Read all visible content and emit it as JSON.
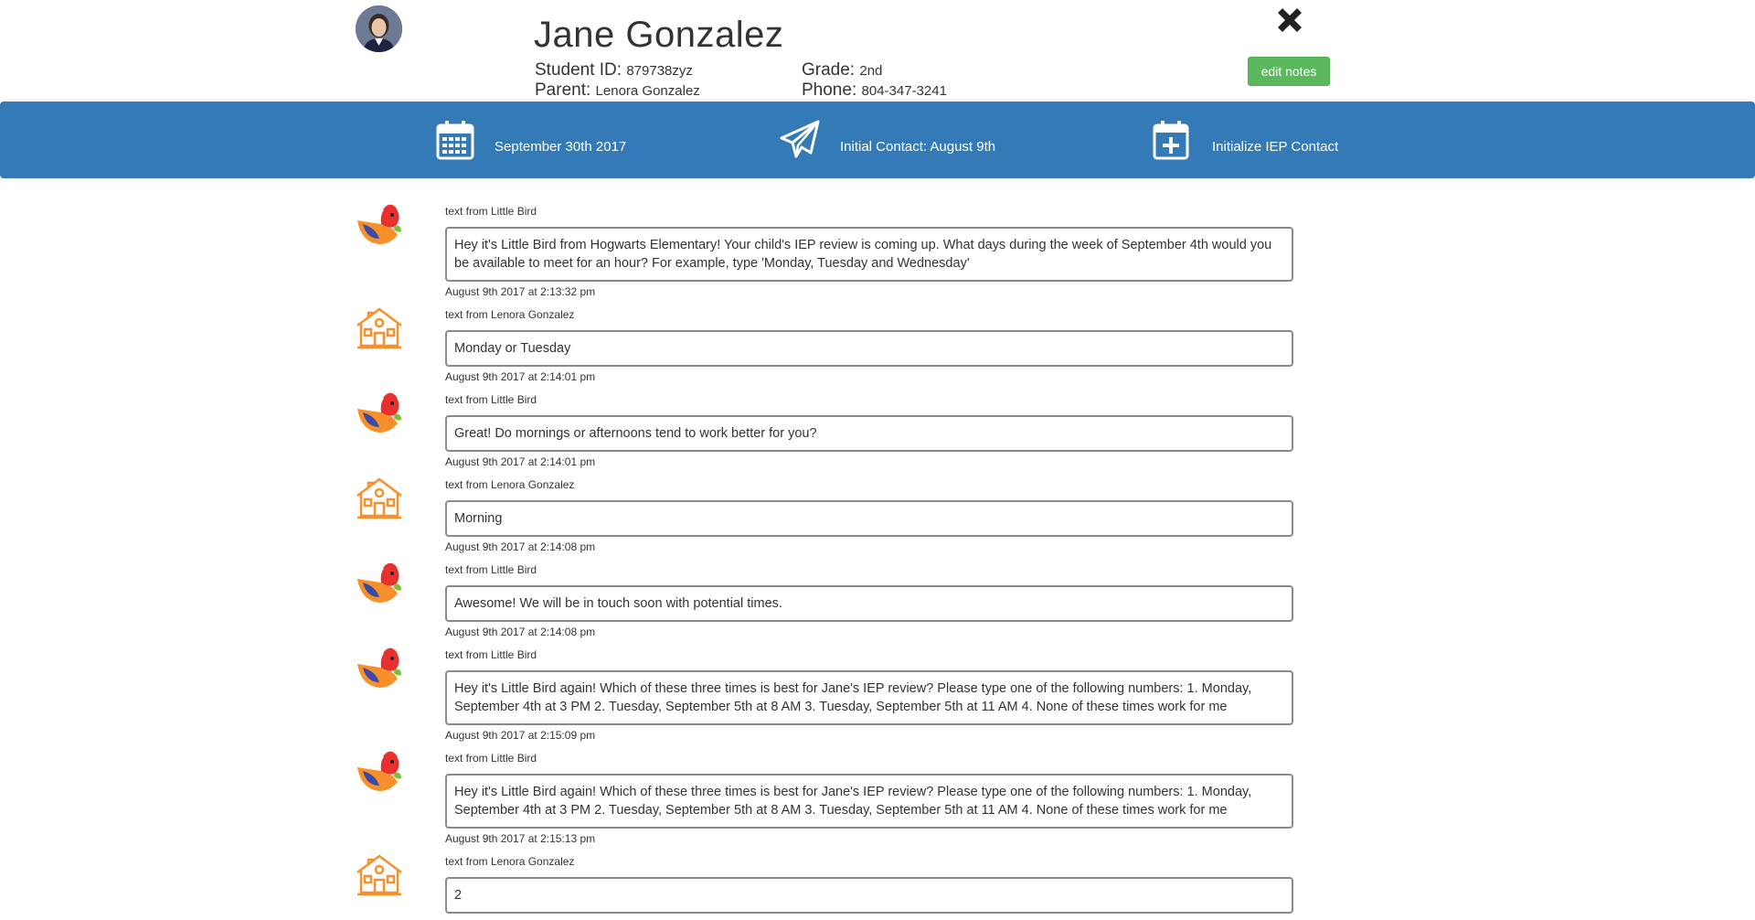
{
  "student": {
    "name": "Jane Gonzalez",
    "student_id_label": "Student ID:",
    "student_id": "879738zyz",
    "parent_label": "Parent:",
    "parent": "Lenora Gonzalez",
    "grade_label": "Grade:",
    "grade": "2nd",
    "phone_label": "Phone:",
    "phone": "804-347-3241"
  },
  "header": {
    "edit_notes_label": "edit notes"
  },
  "banner": {
    "color": "#337ab7",
    "items": [
      {
        "icon": "calendar-icon",
        "label": "September 30th 2017"
      },
      {
        "icon": "paper-plane-icon",
        "label": "Initial Contact: August 9th"
      },
      {
        "icon": "calendar-plus-icon",
        "label": "Initialize IEP Contact"
      }
    ]
  },
  "messages": [
    {
      "sender": "bird",
      "from": "text from Little Bird",
      "text": "Hey it's Little Bird from Hogwarts Elementary! Your child's IEP review is coming up. What days during the week of September 4th would you be available to meet for an hour? For example, type 'Monday, Tuesday and Wednesday'",
      "time": "August 9th 2017 at 2:13:32 pm"
    },
    {
      "sender": "home",
      "from": "text from Lenora Gonzalez",
      "text": "Monday or Tuesday",
      "time": "August 9th 2017 at 2:14:01 pm"
    },
    {
      "sender": "bird",
      "from": "text from Little Bird",
      "text": "Great! Do mornings or afternoons tend to work better for you?",
      "time": "August 9th 2017 at 2:14:01 pm"
    },
    {
      "sender": "home",
      "from": "text from Lenora Gonzalez",
      "text": "Morning",
      "time": "August 9th 2017 at 2:14:08 pm"
    },
    {
      "sender": "bird",
      "from": "text from Little Bird",
      "text": "Awesome! We will be in touch soon with potential times.",
      "time": "August 9th 2017 at 2:14:08 pm"
    },
    {
      "sender": "bird",
      "from": "text from Little Bird",
      "text": "Hey it's Little Bird again! Which of these three times is best for Jane's IEP review? Please type one of the following numbers: 1. Monday, September 4th at 3 PM 2. Tuesday, September 5th at 8 AM 3. Tuesday, September 5th at 11 AM 4. None of these times work for me",
      "time": "August 9th 2017 at 2:15:09 pm"
    },
    {
      "sender": "bird",
      "from": "text from Little Bird",
      "text": "Hey it's Little Bird again! Which of these three times is best for Jane's IEP review? Please type one of the following numbers: 1. Monday, September 4th at 3 PM 2. Tuesday, September 5th at 8 AM 3. Tuesday, September 5th at 11 AM 4. None of these times work for me",
      "time": "August 9th 2017 at 2:15:13 pm"
    },
    {
      "sender": "home",
      "from": "text from Lenora Gonzalez",
      "text": "2",
      "time": ""
    }
  ]
}
